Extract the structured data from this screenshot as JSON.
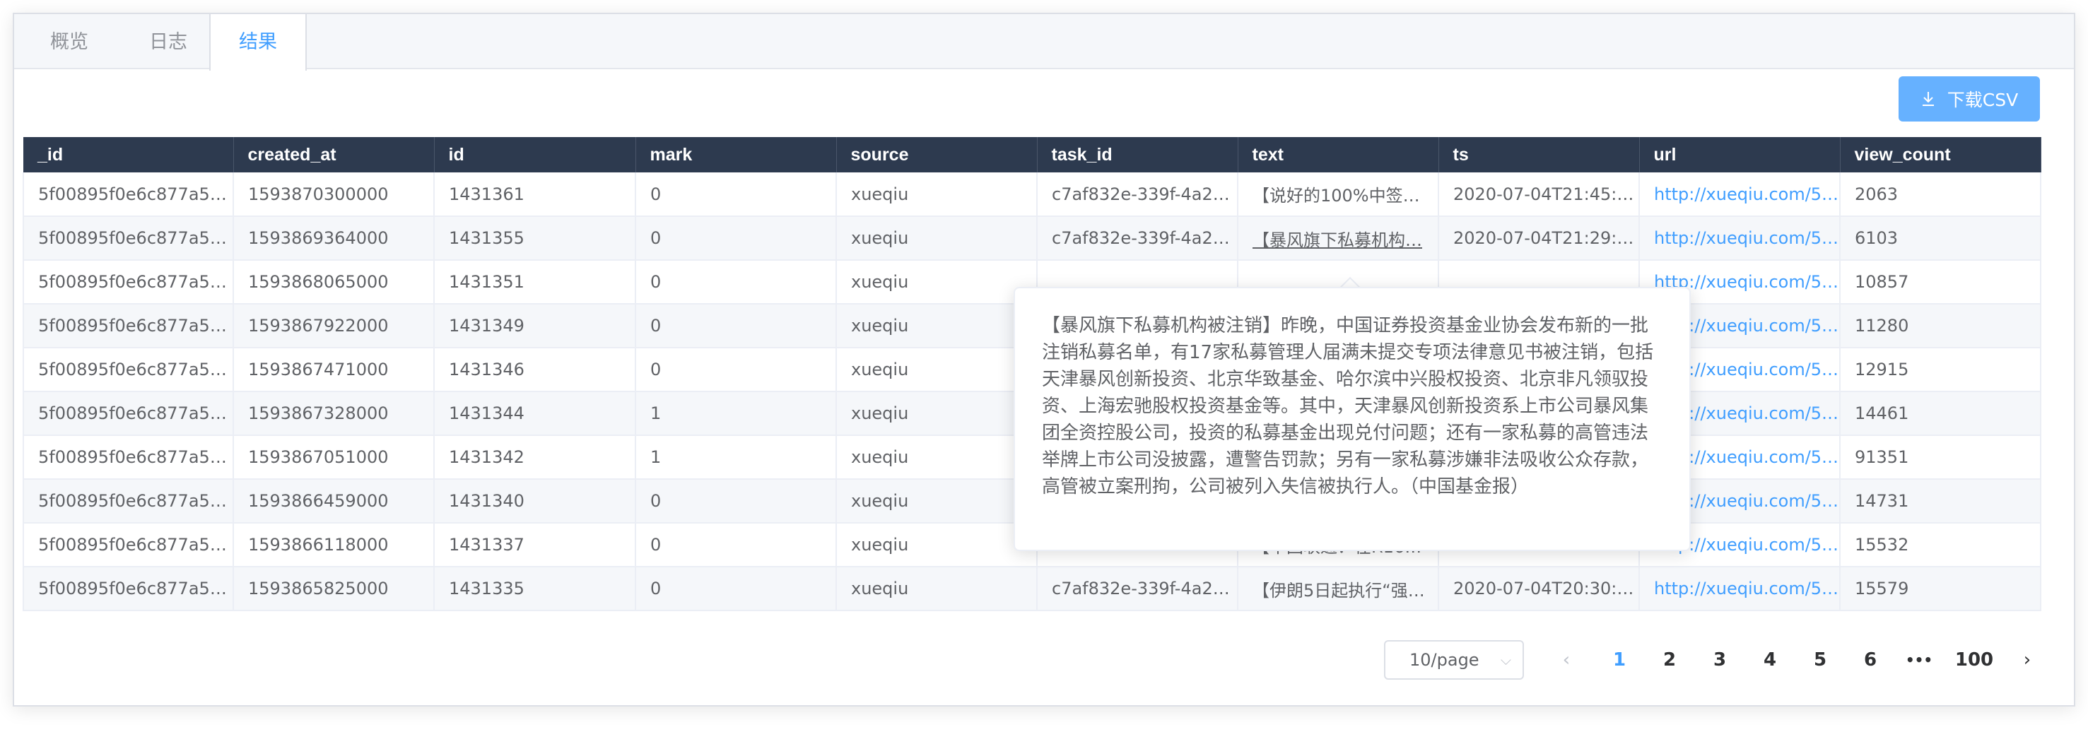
{
  "tabs": [
    {
      "label": "概览",
      "active": false
    },
    {
      "label": "日志",
      "active": false
    },
    {
      "label": "结果",
      "active": true
    }
  ],
  "toolbar": {
    "download_label": "下载CSV",
    "download_icon": "download-icon"
  },
  "table": {
    "columns": [
      "_id",
      "created_at",
      "id",
      "mark",
      "source",
      "task_id",
      "text",
      "ts",
      "url",
      "view_count"
    ],
    "rows": [
      [
        "5f00895f0e6c877a54…",
        "1593870300000",
        "1431361",
        "0",
        "xueqiu",
        "c7af832e-339f-4a2c…",
        "【说好的100%中签…",
        "2020-07-04T21:45:…",
        "http://xueqiu.com/5…",
        "2063"
      ],
      [
        "5f00895f0e6c877a54…",
        "1593869364000",
        "1431355",
        "0",
        "xueqiu",
        "c7af832e-339f-4a2c…",
        "【暴风旗下私募机构…",
        "2020-07-04T21:29:…",
        "http://xueqiu.com/5…",
        "6103"
      ],
      [
        "5f00895f0e6c877a54…",
        "1593868065000",
        "1431351",
        "0",
        "xueqiu",
        "",
        "",
        "",
        "http://xueqiu.com/5…",
        "10857"
      ],
      [
        "5f00895f0e6c877a54…",
        "1593867922000",
        "1431349",
        "0",
        "xueqiu",
        "",
        "",
        "",
        "http://xueqiu.com/5…",
        "11280"
      ],
      [
        "5f00895f0e6c877a54…",
        "1593867471000",
        "1431346",
        "0",
        "xueqiu",
        "",
        "",
        "",
        "http://xueqiu.com/5…",
        "12915"
      ],
      [
        "5f00895f0e6c877a54…",
        "1593867328000",
        "1431344",
        "1",
        "xueqiu",
        "",
        "",
        "",
        "http://xueqiu.com/5…",
        "14461"
      ],
      [
        "5f00895f0e6c877a54…",
        "1593867051000",
        "1431342",
        "1",
        "xueqiu",
        "",
        "",
        "",
        "http://xueqiu.com/5…",
        "91351"
      ],
      [
        "5f00895f0e6c877a54…",
        "1593866459000",
        "1431340",
        "0",
        "xueqiu",
        "",
        "",
        "",
        "http://xueqiu.com/5…",
        "14731"
      ],
      [
        "5f00895f0e6c877a54…",
        "1593866118000",
        "1431337",
        "0",
        "xueqiu",
        "c7af832e-339f-4a2c…",
        "【中国联通：在R16…",
        "2020-07-04T20:35:…",
        "http://xueqiu.com/5…",
        "15532"
      ],
      [
        "5f00895f0e6c877a54…",
        "1593865825000",
        "1431335",
        "0",
        "xueqiu",
        "c7af832e-339f-4a2c…",
        "【伊朗5日起执行“强…",
        "2020-07-04T20:30:…",
        "http://xueqiu.com/5…",
        "15579"
      ]
    ]
  },
  "tooltip": {
    "text": "【暴风旗下私募机构被注销】昨晚，中国证券投资基金业协会发布新的一批注销私募名单，有17家私募管理人届满未提交专项法律意见书被注销，包括天津暴风创新投资、北京华致基金、哈尔滨中兴股权投资、北京非凡领驭投资、上海宏驰股权投资基金等。其中，天津暴风创新投资系上市公司暴风集团全资控股公司，投资的私募基金出现兑付问题；还有一家私募的高管违法举牌上市公司没披露，遭警告罚款；另有一家私募涉嫌非法吸收公众存款，高管被立案刑拘，公司被列入失信被执行人。（中国基金报）"
  },
  "pagination": {
    "page_size": "10/page",
    "prev": "‹",
    "next": "›",
    "pages": [
      "1",
      "2",
      "3",
      "4",
      "5",
      "6",
      "•••",
      "100"
    ],
    "current": "1"
  },
  "colors": {
    "accent": "#409eff",
    "header_bg": "#2d3a4f",
    "button_bg": "#66b1ff"
  }
}
